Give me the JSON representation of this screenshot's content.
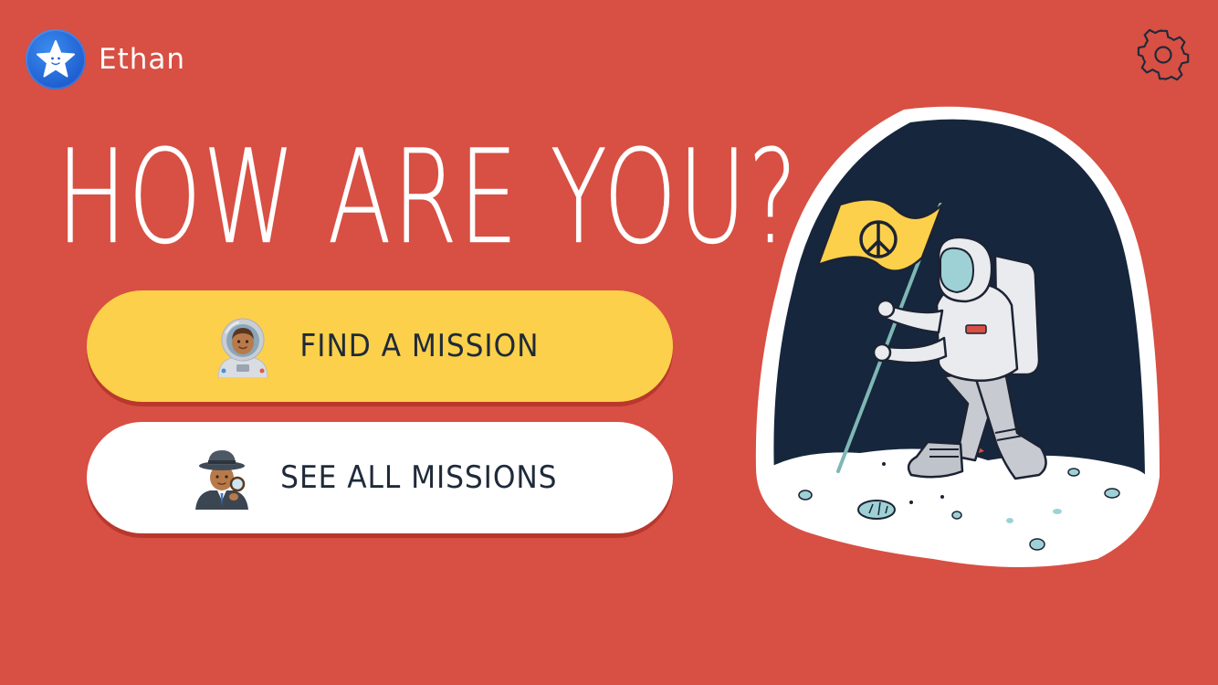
{
  "user": {
    "name": "Ethan",
    "avatar_icon": "star-face-icon"
  },
  "header": {
    "settings_icon": "gear-icon"
  },
  "main": {
    "heading": "HOW ARE YOU?",
    "buttons": [
      {
        "label": "FIND A MISSION",
        "icon": "astronaut-emoji-icon",
        "color": "#fcd04a"
      },
      {
        "label": "SEE ALL MISSIONS",
        "icon": "detective-emoji-icon",
        "color": "#ffffff"
      }
    ]
  },
  "illustration": {
    "icon": "astronaut-moon-flag-illustration"
  },
  "colors": {
    "background": "#d84f43",
    "primary_button": "#fcd04a",
    "secondary_button": "#ffffff",
    "text_dark": "#1f2a3a"
  }
}
